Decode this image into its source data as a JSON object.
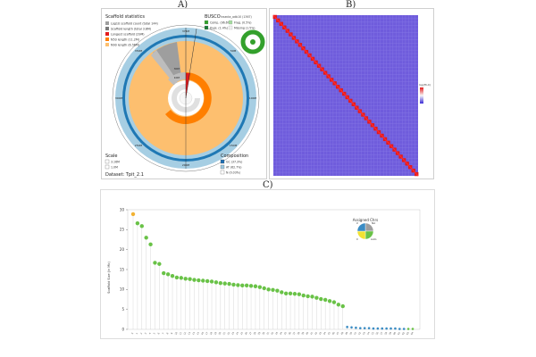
{
  "panels": {
    "a": "A)",
    "b": "B)",
    "c": "C)"
  },
  "snail": {
    "stats_title": "Scaffold statistics",
    "stats_items": [
      {
        "label": "Log10 scaffold count (total 144)",
        "color": "#9e9e9e"
      },
      {
        "label": "Scaffold length (total 3.6M)",
        "color": "#7a7a7a"
      },
      {
        "label": "Longest scaffold (29M)",
        "color": "#e31a1c"
      },
      {
        "label": "N50 length (11.2M)",
        "color": "#ff7f00"
      },
      {
        "label": "N90 length (6.56M)",
        "color": "#fdbf6f"
      }
    ],
    "busco_title": "BUSCO",
    "busco_subtitle": "insecta_odb10 (1367)",
    "busco_items": [
      {
        "label": "Comp. (96.6%)",
        "color": "#33a02c"
      },
      {
        "label": "Frag. (0.5%)",
        "color": "#a6dba0"
      },
      {
        "label": "Dupl. (1.4%)",
        "color": "#1b7837"
      },
      {
        "label": "Missing (1.5%)",
        "color": "#f0f0f0"
      }
    ],
    "scale_title": "Scale",
    "scale_items": [
      "3.16M",
      "1.0M"
    ],
    "composition_title": "Composition",
    "composition_items": [
      {
        "label": "GC (37.3%)",
        "color": "#1f6fb4"
      },
      {
        "label": "AT (62.7%)",
        "color": "#9ecae1"
      },
      {
        "label": "N (0.03%)",
        "color": "#ffffff"
      }
    ],
    "dataset": "Dataset: Tpit_2.1",
    "ring_labels": [
      "374M",
      "50M",
      "100M",
      "150M",
      "200M",
      "250M",
      "300M",
      "350M"
    ],
    "inner_labels": [
      "30M",
      "10M"
    ]
  },
  "hic": {
    "legend_title": "log(Hi-C)",
    "scaffold_count": 46
  },
  "chart_data": {
    "type": "scatter",
    "title": "",
    "xlabel": "",
    "ylabel": "Scaffold Size (in Mb)",
    "ylim": [
      0,
      30
    ],
    "yticks": [
      0,
      5,
      10,
      15,
      20,
      25,
      30
    ],
    "x": [
      "X",
      "1",
      "2",
      "3",
      "4",
      "5",
      "6",
      "7",
      "8",
      "9",
      "10",
      "11",
      "12",
      "13",
      "14",
      "15",
      "16",
      "17",
      "18",
      "19",
      "20",
      "21",
      "22",
      "23",
      "24",
      "25",
      "26",
      "27",
      "28",
      "29",
      "30",
      "31",
      "32",
      "33",
      "34",
      "35",
      "36",
      "37",
      "38",
      "39",
      "40",
      "41",
      "42",
      "43",
      "44",
      "45",
      "46",
      "47",
      "48",
      "49",
      "50",
      "51",
      "52",
      "53",
      "54",
      "55",
      "56",
      "57",
      "58",
      "59",
      "60",
      "61",
      "62",
      "63",
      "64"
    ],
    "values": [
      28.9,
      26.6,
      25.9,
      23.0,
      21.3,
      16.7,
      16.4,
      14.1,
      13.8,
      13.4,
      13.0,
      12.9,
      12.7,
      12.6,
      12.4,
      12.3,
      12.2,
      12.1,
      12.0,
      11.8,
      11.6,
      11.5,
      11.4,
      11.2,
      11.1,
      11.0,
      11.0,
      10.9,
      10.8,
      10.6,
      10.3,
      10.0,
      9.9,
      9.7,
      9.3,
      9.0,
      9.0,
      8.9,
      8.8,
      8.5,
      8.3,
      8.2,
      7.9,
      7.6,
      7.4,
      7.1,
      6.8,
      6.2,
      5.8,
      0.6,
      0.5,
      0.4,
      0.3,
      0.3,
      0.3,
      0.2,
      0.2,
      0.2,
      0.2,
      0.2,
      0.2,
      0.1,
      0.1,
      0.1,
      0.1
    ],
    "groups": [
      "X",
      "A",
      "A",
      "A",
      "A",
      "A",
      "A",
      "A",
      "A",
      "A",
      "A",
      "A",
      "A",
      "A",
      "A",
      "A",
      "A",
      "A",
      "A",
      "A",
      "A",
      "A",
      "A",
      "A",
      "A",
      "A",
      "A",
      "A",
      "A",
      "A",
      "A",
      "A",
      "A",
      "A",
      "A",
      "A",
      "A",
      "A",
      "A",
      "A",
      "A",
      "A",
      "A",
      "A",
      "A",
      "A",
      "A",
      "A",
      "A",
      "U",
      "U",
      "U",
      "U",
      "U",
      "U",
      "U",
      "U",
      "U",
      "U",
      "U",
      "U",
      "U",
      "U",
      "A",
      "A"
    ],
    "group_colors": {
      "X": "#f2b233",
      "A": "#69c247",
      "U": "#3a8cc4",
      "N": "#9e9e9e"
    },
    "legend": {
      "title": "Assigned Chrs",
      "placement": "top-right",
      "pie": [
        {
          "label": "NA",
          "value": 25,
          "color": "#9e9e9e"
        },
        {
          "label": "Auto",
          "value": 25,
          "color": "#69c247"
        },
        {
          "label": "X",
          "value": 25,
          "color": "#f2e233"
        },
        {
          "label": "U",
          "value": 25,
          "color": "#3a8cc4"
        }
      ]
    },
    "grid": false
  }
}
